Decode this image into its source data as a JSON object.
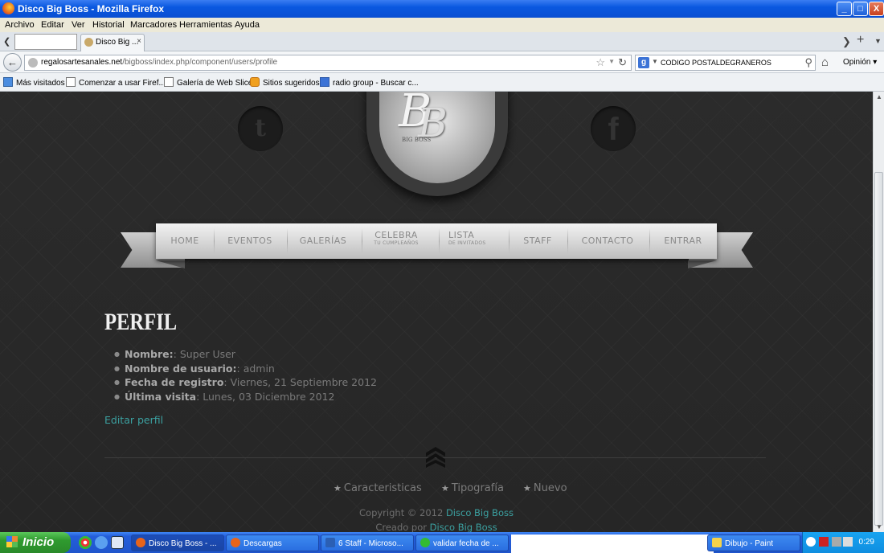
{
  "window": {
    "title": "Disco Big Boss - Mozilla Firefox",
    "buttons": [
      "_",
      "□",
      "X"
    ]
  },
  "menu": [
    "Archivo",
    "Editar",
    "Ver",
    "Historial",
    "Marcadores",
    "Herramientas",
    "Ayuda"
  ],
  "tabs": {
    "active_label": "Disco Big ...",
    "close": "×"
  },
  "navbar": {
    "url_host": "regalosartesanales.net",
    "url_path": "/bigboss/index.php/component/users/profile",
    "search_value": "CODIGO POSTALDEGRANEROS",
    "search_engine_icon": "g",
    "opinion": "Opinión"
  },
  "bookmarks": [
    "Más visitados",
    "Comenzar a usar Firef...",
    "Galería de Web Slice",
    "Sitios sugeridos",
    "radio group - Buscar c..."
  ],
  "site": {
    "social_twitter": "t",
    "social_facebook": "f",
    "logo_letters": "B",
    "logo_letters2": "B",
    "logo_text": "BIG BOSS",
    "nav": [
      {
        "label": "HOME"
      },
      {
        "label": "EVENTOS"
      },
      {
        "label": "GALERÍAS"
      },
      {
        "label": "CELEBRA",
        "sub": "TU CUMPLEAÑOS"
      },
      {
        "label": "LISTA",
        "sub": "DE INVITADOS"
      },
      {
        "label": "STAFF"
      },
      {
        "label": "CONTACTO"
      },
      {
        "label": "ENTRAR"
      }
    ],
    "page_title": "PERFIL",
    "details": [
      {
        "key": "Nombre:",
        "sep": ": ",
        "value": "Super User"
      },
      {
        "key": "Nombre de usuario:",
        "sep": ": ",
        "value": "admin"
      },
      {
        "key": "Fecha de registro",
        "sep": ": ",
        "value": "Viernes, 21 Septiembre 2012"
      },
      {
        "key": "Última visita",
        "sep": ": ",
        "value": "Lunes, 03 Diciembre 2012"
      }
    ],
    "edit_link": "Editar perfil",
    "footer_links": [
      "Caracteristicas",
      "Tipografía",
      "Nuevo"
    ],
    "copyright_text": "Copyright © 2012 ",
    "copyright_link": "Disco Big Boss",
    "created_text": "Creado por ",
    "created_link": "Disco Big Boss"
  },
  "taskbar": {
    "start": "Inicio",
    "tasks": [
      "Disco Big Boss - ...",
      "Descargas",
      "6 Staff - Microso...",
      "validar fecha de ...",
      "Dibujo - Paint"
    ],
    "clock": "0:29"
  }
}
